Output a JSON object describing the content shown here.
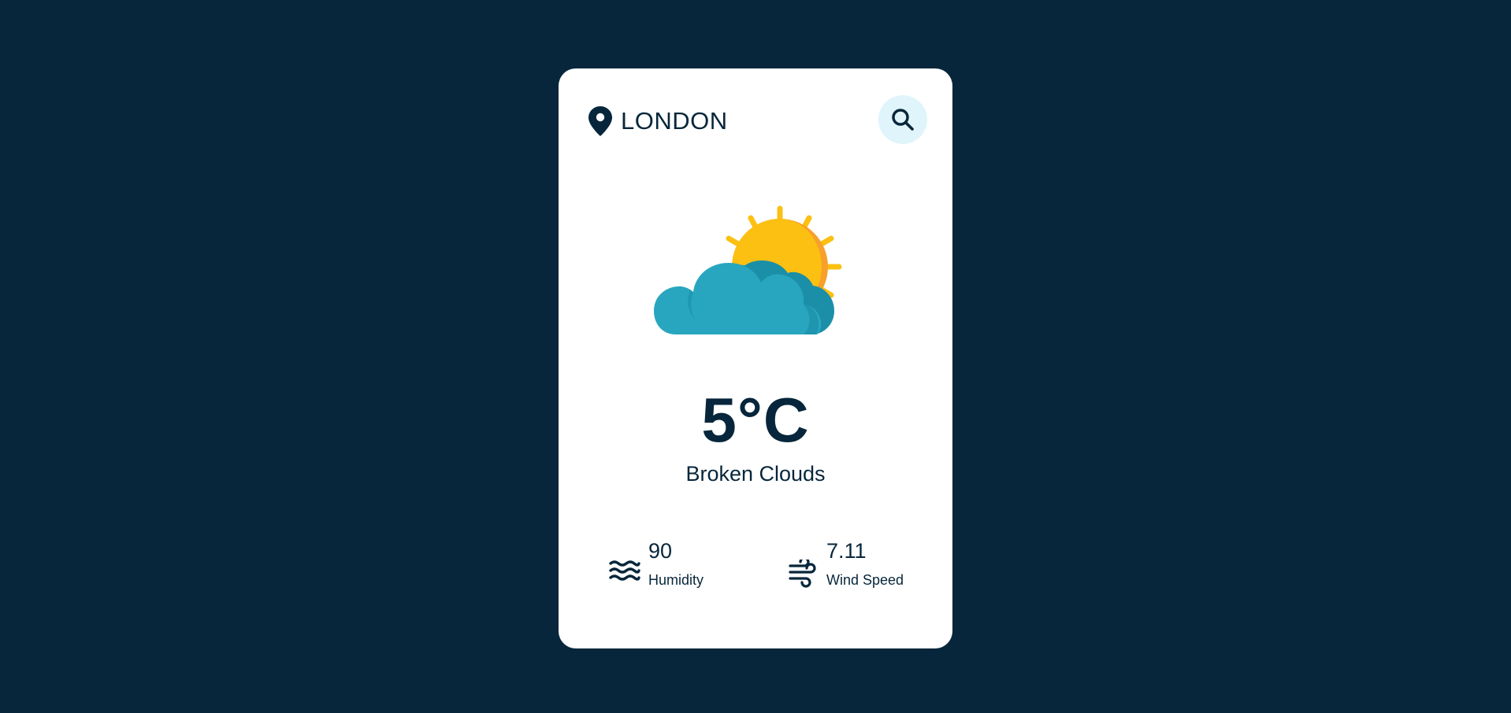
{
  "location": {
    "city": "LONDON",
    "icon": "location-pin-icon"
  },
  "search": {
    "icon": "search-icon"
  },
  "weather": {
    "icon": "sun-behind-cloud-icon",
    "temperature": "5°C",
    "description": "Broken Clouds"
  },
  "stats": {
    "humidity": {
      "value": "90",
      "label": "Humidity",
      "icon": "waves-icon"
    },
    "wind": {
      "value": "7.11",
      "label": "Wind Speed",
      "icon": "wind-icon"
    }
  },
  "colors": {
    "background": "#07263b",
    "card": "#ffffff",
    "text": "#07263b",
    "search_button": "#dff4fb",
    "sun": "#fbc012",
    "sun_shade": "#f7a02b",
    "cloud": "#29a6bf",
    "cloud_shade": "#1b8fa8"
  }
}
